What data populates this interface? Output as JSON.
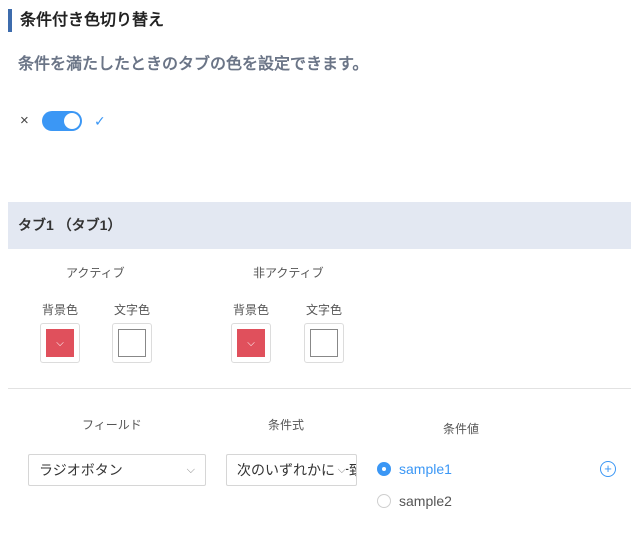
{
  "section": {
    "title": "条件付き色切り替え",
    "description": "条件を満たしたときのタブの色を設定できます。"
  },
  "toggle": {
    "on": true,
    "off_icon": "close-icon",
    "on_icon": "check-icon",
    "off_glyph": "×",
    "on_glyph": "✓"
  },
  "tab": {
    "header": "タブ1 （タブ1）",
    "active": {
      "label": "アクティブ",
      "background_label": "背景色",
      "text_label": "文字色",
      "background_color": "#e0505c",
      "text_color": "#ffffff"
    },
    "inactive": {
      "label": "非アクティブ",
      "background_label": "背景色",
      "text_label": "文字色",
      "background_color": "#e0505c",
      "text_color": "#ffffff"
    }
  },
  "condition": {
    "field_label": "フィールド",
    "expression_label": "条件式",
    "value_label": "条件値",
    "field_value": "ラジオボタン",
    "expression_value": "次のいずれかに一致する",
    "options": [
      {
        "label": "sample1",
        "selected": true
      },
      {
        "label": "sample2",
        "selected": false
      }
    ]
  },
  "icons": {
    "chevron": "⌵",
    "add": "+"
  }
}
